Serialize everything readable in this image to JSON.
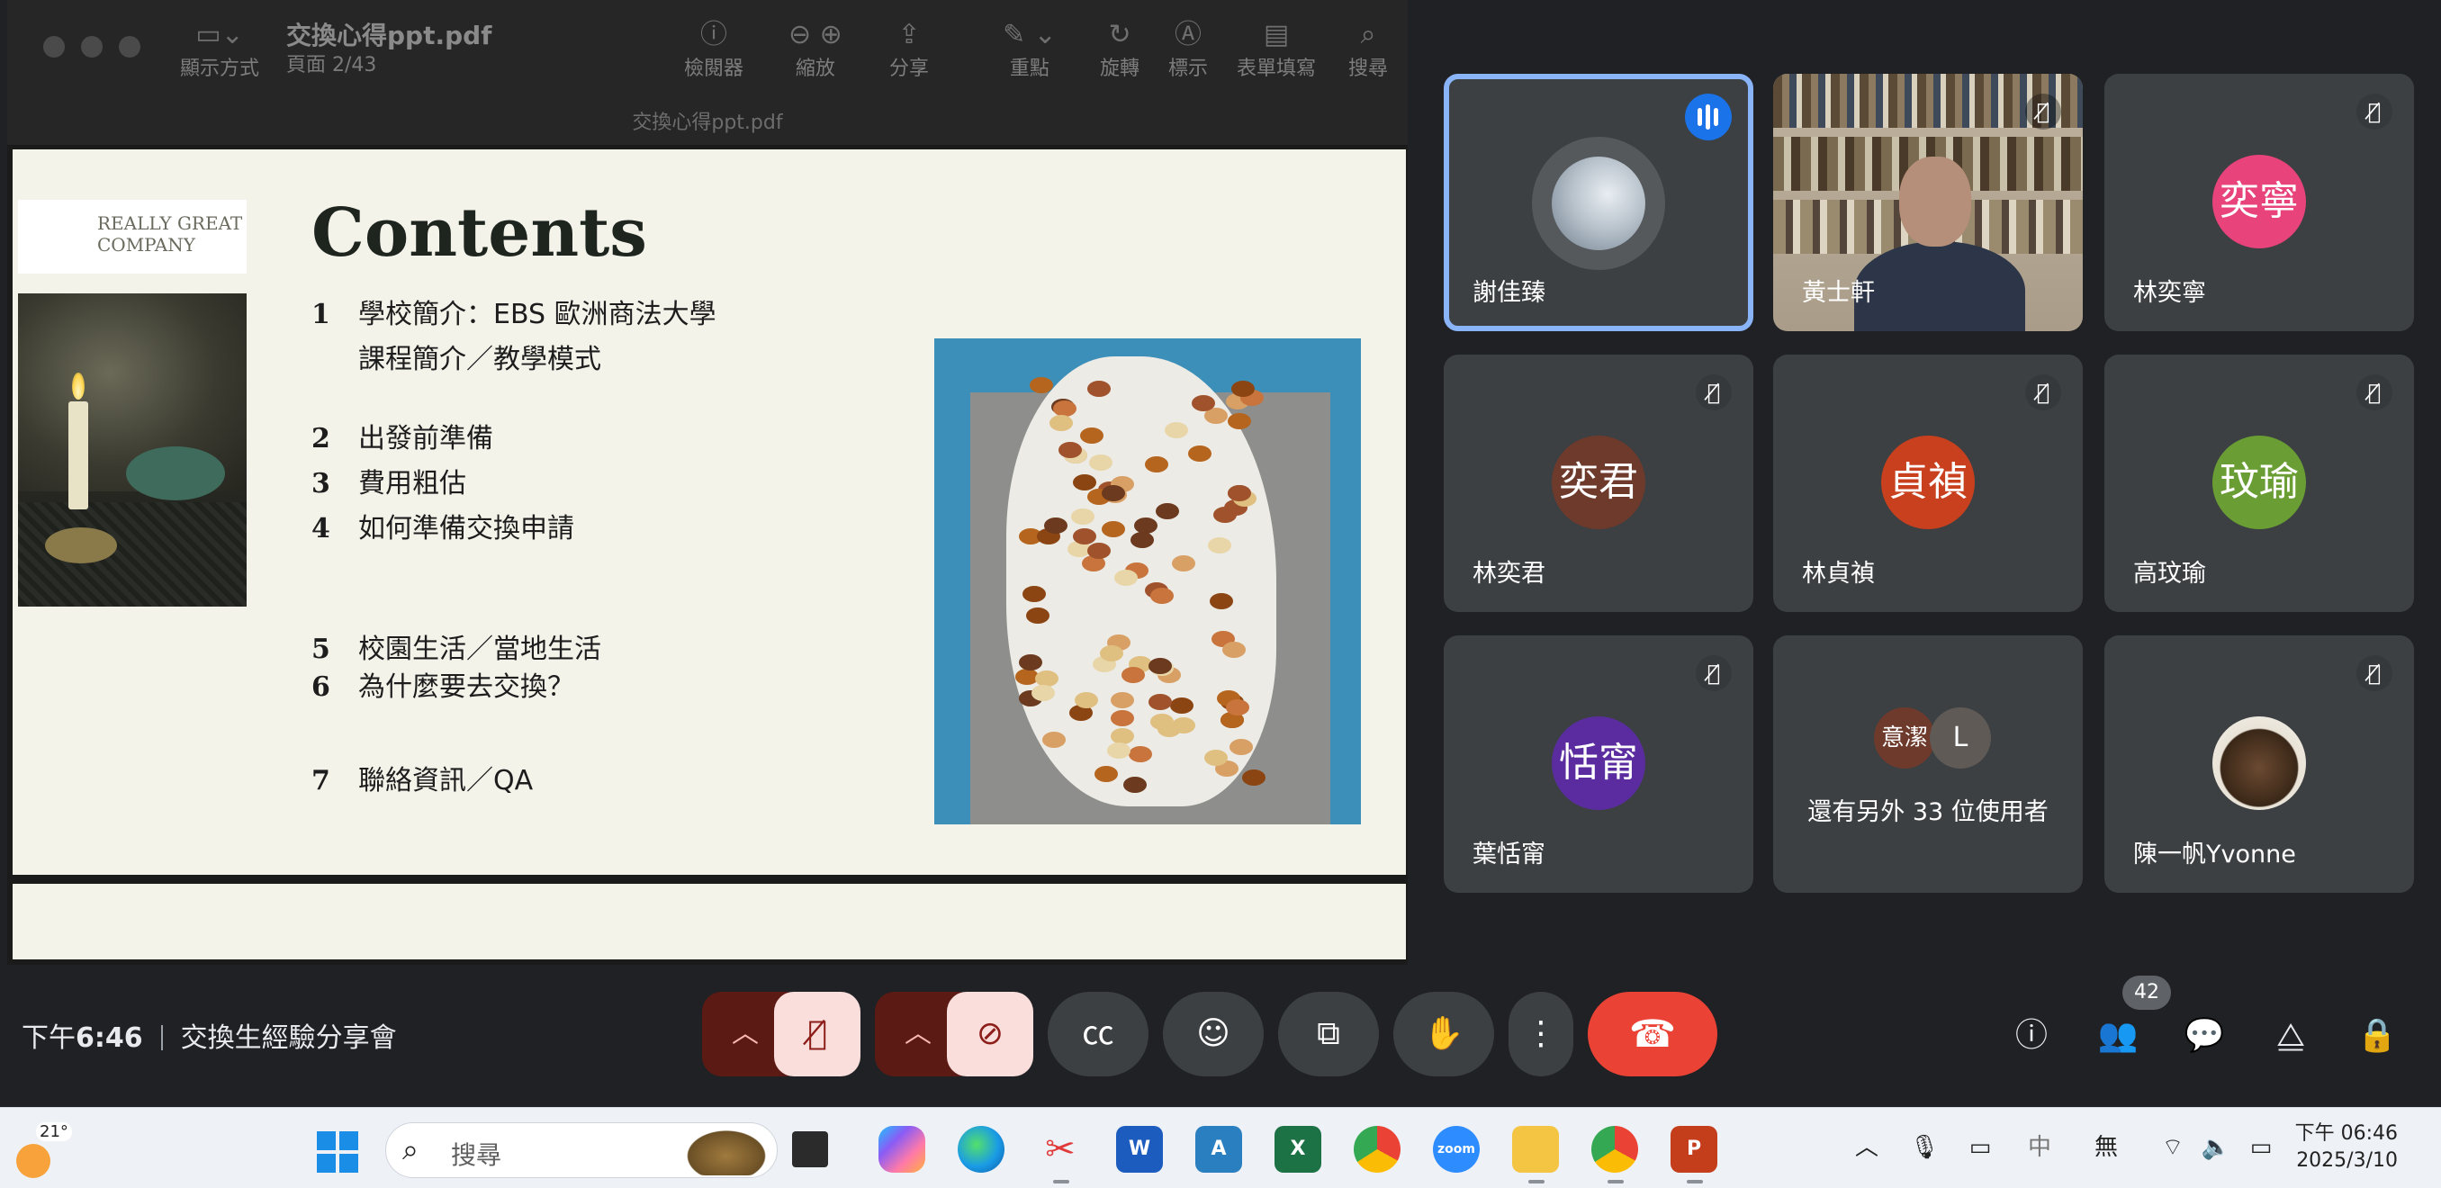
{
  "pdf_viewer": {
    "view_label": "顯示方式",
    "doc_title": "交換心得ppt.pdf",
    "page_indicator": "頁面 2/43",
    "window_subtitle": "交換心得ppt.pdf",
    "toolbar": {
      "inspector": "檢閱器",
      "zoom": "縮放",
      "share": "分享",
      "highlight": "重點",
      "rotate": "旋轉",
      "markup": "標示",
      "form_fill": "表單填寫",
      "search": "搜尋"
    }
  },
  "slide": {
    "company": "REALLY GREAT COMPANY",
    "title": "Contents",
    "items": [
      {
        "num": "1",
        "text": "學校簡介：EBS 歐洲商法大學"
      },
      {
        "num": "",
        "text": "課程簡介／教學模式"
      },
      {
        "num": "2",
        "text": "出發前準備"
      },
      {
        "num": "3",
        "text": "費用粗估"
      },
      {
        "num": "4",
        "text": "如何準備交換申請"
      },
      {
        "num": "5",
        "text": "校園生活／當地生活"
      },
      {
        "num": "6",
        "text": "為什麼要去交換？"
      },
      {
        "num": "7",
        "text": "聯絡資訊／QA"
      }
    ]
  },
  "participants": {
    "p1": {
      "name": "謝佳臻"
    },
    "p2": {
      "name": "黃士軒"
    },
    "p3": {
      "name": "林奕寧",
      "initials": "奕寧",
      "color": "#e8437a"
    },
    "p4": {
      "name": "林奕君",
      "initials": "奕君",
      "color": "#6d3a2c"
    },
    "p5": {
      "name": "林貞禎",
      "initials": "貞禎",
      "color": "#c8401e"
    },
    "p6": {
      "name": "高玟瑜",
      "initials": "玟瑜",
      "color": "#6a9e34"
    },
    "p7": {
      "name": "葉恬甯",
      "initials": "恬甯",
      "color": "#5a2ca0"
    },
    "more": {
      "av1": "意潔",
      "av2": "L",
      "text": "還有另外 33 位使用者"
    },
    "p9": {
      "name": "陳一帆Yvonne"
    }
  },
  "meeting": {
    "time_prefix": "下午",
    "time": "6:46",
    "title": "交換生經驗分享會",
    "participant_count": "42"
  },
  "taskbar": {
    "temperature": "21°",
    "search_placeholder": "搜尋",
    "ime_label": "中",
    "ime_mode": "無",
    "clock_time": "下午 06:46",
    "clock_date": "2025/3/10"
  }
}
